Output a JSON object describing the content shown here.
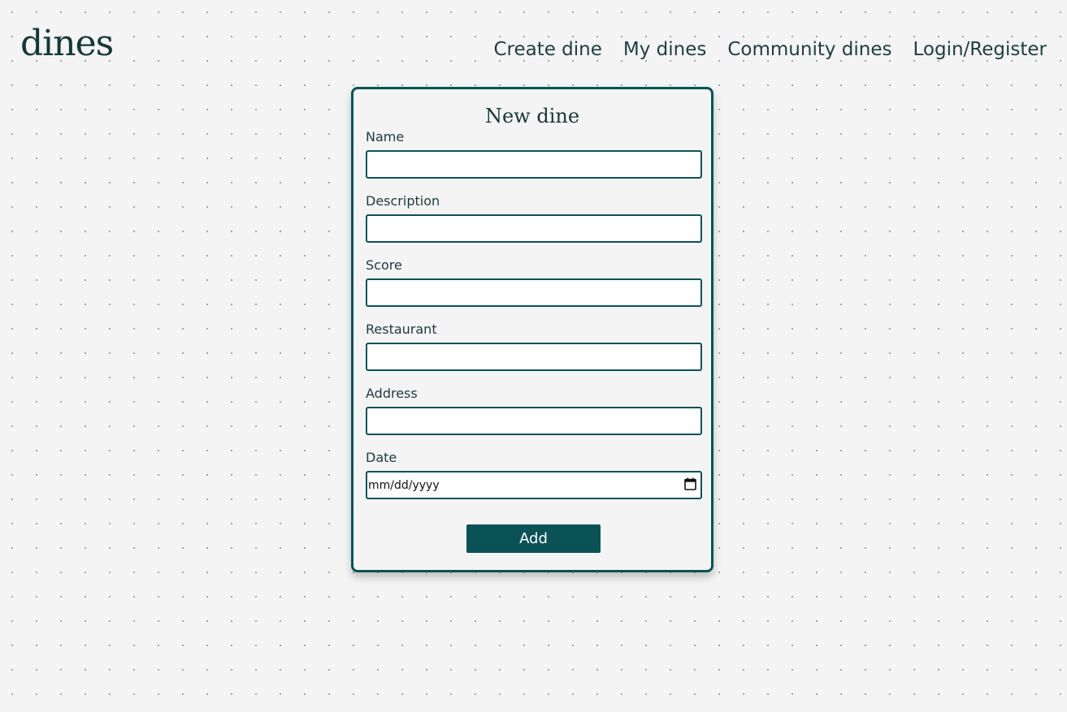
{
  "app": {
    "logo": "dines"
  },
  "nav": {
    "items": [
      {
        "label": "Create dine"
      },
      {
        "label": "My dines"
      },
      {
        "label": "Community dines"
      },
      {
        "label": "Login/Register"
      }
    ]
  },
  "form": {
    "title": "New dine",
    "fields": [
      {
        "label": "Name",
        "value": ""
      },
      {
        "label": "Description",
        "value": ""
      },
      {
        "label": "Score",
        "value": ""
      },
      {
        "label": "Restaurant",
        "value": ""
      },
      {
        "label": "Address",
        "value": ""
      },
      {
        "label": "Date",
        "value": "mm/dd/yyyy"
      }
    ],
    "submit_label": "Add"
  },
  "colors": {
    "accent": "#0b5257",
    "background": "#f4f4f4",
    "text": "#1e3a3a"
  },
  "icons": {
    "date_picker": "calendar-icon"
  }
}
